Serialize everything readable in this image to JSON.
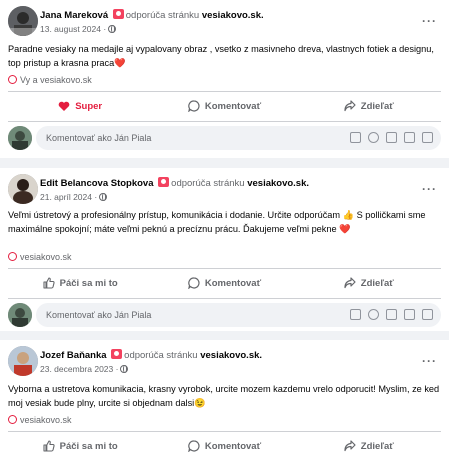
{
  "posts": [
    {
      "author": "Jana Mareková",
      "recommends_text": "odporúča stránku",
      "page_name": "vesiakovo.sk.",
      "date": "13. august 2024 ·",
      "text": "Paradne vesiaky na medajle aj vypalovany obraz , vsetko z masivneho dreva, vlastnych fotiek a designu, top pristup a krasna praca",
      "text_emoji": "❤️",
      "link_label": "Vy a vesiakovo.sk",
      "actions": {
        "like": "Super",
        "comment": "Komentovať",
        "share": "Zdieľať"
      },
      "comment_placeholder": "Komentovať ako Ján Piala"
    },
    {
      "author": "Edit Belancova Stopkova",
      "recommends_text": "odporúča stránku",
      "page_name": "vesiakovo.sk.",
      "date": "21. apríl 2024 ·",
      "text": "Veľmi ústretový a profesionálny prístup, komunikácia i dodanie. Určite odporúčam 👍 S polličkami sme maximálne spokojní; máte veľmi peknú a precíznu prácu. Ďakujeme veľmi pekne",
      "text_emoji": "❤️",
      "link_label": "vesiakovo.sk",
      "actions": {
        "like": "Páči sa mi to",
        "comment": "Komentovať",
        "share": "Zdieľať"
      },
      "comment_placeholder": "Komentovať ako Ján Piala"
    },
    {
      "author": "Jozef Baňanka",
      "recommends_text": "odporúča stránku",
      "page_name": "vesiakovo.sk.",
      "date": "23. decembra 2023 ·",
      "text": "Vyborna a ustretova komunikacia, krasny vyrobok, urcite mozem kazdemu vrelo odporucit! Myslim, ze ked moj vesiak bude plny, urcite si objednam dalsi😉",
      "text_emoji": "",
      "link_label": "vesiakovo.sk",
      "actions": {
        "like": "Páči sa mi to",
        "comment": "Komentovať",
        "share": "Zdieľať"
      },
      "comment_placeholder": ""
    }
  ],
  "icons": [
    "recommend-icon",
    "globe-icon",
    "more-icon",
    "heart-icon",
    "like-icon",
    "comment-icon",
    "share-icon",
    "emoji-icon",
    "camera-icon",
    "gif-icon",
    "sticker-icon",
    "location-pin-icon"
  ],
  "colors": {
    "accent_red": "#e41e3f",
    "muted_text": "#65676b",
    "background": "#f0f2f5"
  }
}
